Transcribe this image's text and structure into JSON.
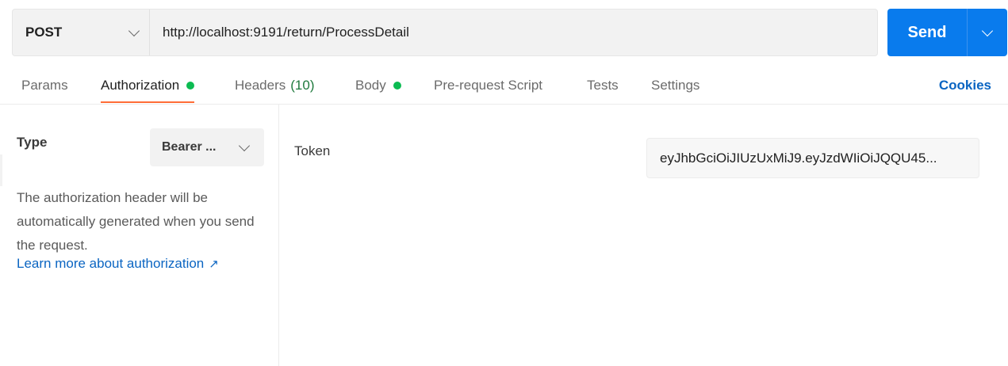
{
  "request": {
    "method": "POST",
    "url": "http://localhost:9191/return/ProcessDetail"
  },
  "send": {
    "label": "Send"
  },
  "tabs": [
    {
      "label": "Params"
    },
    {
      "label": "Authorization"
    },
    {
      "label": "Headers",
      "count": "(10)"
    },
    {
      "label": "Body"
    },
    {
      "label": "Pre-request Script"
    },
    {
      "label": "Tests"
    },
    {
      "label": "Settings"
    }
  ],
  "cookies_label": "Cookies",
  "auth": {
    "type_label": "Type",
    "type_value": "Bearer ...",
    "description": "The authorization header will be automatically generated when you send the request.",
    "learn_more": "Learn more about authorization",
    "learn_more_icon": "↗",
    "token_label": "Token",
    "token_value": "eyJhbGciOiJIUzUxMiJ9.eyJzdWIiOiJQQU45..."
  },
  "colors": {
    "accent": "#ff6c37",
    "send": "#097bed",
    "link": "#0b65c2",
    "status_dot": "#0cbb52"
  }
}
